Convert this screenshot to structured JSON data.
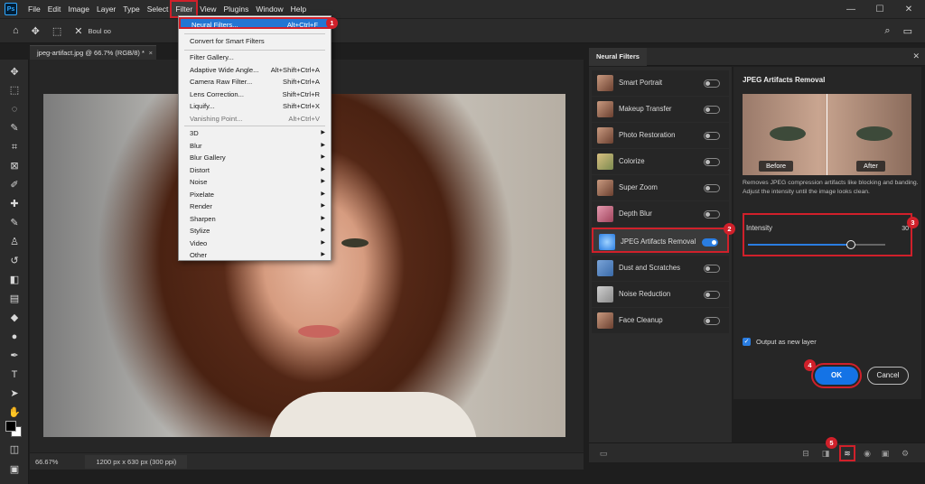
{
  "app": {
    "logo": "Ps"
  },
  "menubar": {
    "items": [
      {
        "label": "File"
      },
      {
        "label": "Edit"
      },
      {
        "label": "Image"
      },
      {
        "label": "Layer"
      },
      {
        "label": "Type"
      },
      {
        "label": "Select"
      },
      {
        "label": "Filter"
      },
      {
        "label": "View"
      },
      {
        "label": "Plugins"
      },
      {
        "label": "Window"
      },
      {
        "label": "Help"
      }
    ],
    "active": "Filter"
  },
  "options_bar": {
    "text": "Boul oo"
  },
  "document": {
    "tab_title": "jpeg-artifact.jpg @ 66.7% (RGB/8) *",
    "zoom": "66.67%",
    "info": "1200 px x 630 px (300 ppi)"
  },
  "filter_menu": {
    "neural_filters": {
      "label": "Neural Filters...",
      "shortcut": "Alt+Ctrl+F"
    },
    "convert": {
      "label": "Convert for Smart Filters"
    },
    "filter_gallery": {
      "label": "Filter Gallery..."
    },
    "adaptive_wide_angle": {
      "label": "Adaptive Wide Angle...",
      "shortcut": "Alt+Shift+Ctrl+A"
    },
    "camera_raw": {
      "label": "Camera Raw Filter...",
      "shortcut": "Shift+Ctrl+A"
    },
    "lens_correction": {
      "label": "Lens Correction...",
      "shortcut": "Shift+Ctrl+R"
    },
    "liquify": {
      "label": "Liquify...",
      "shortcut": "Shift+Ctrl+X"
    },
    "vanishing_point": {
      "label": "Vanishing Point...",
      "shortcut": "Alt+Ctrl+V"
    },
    "submenus": [
      "3D",
      "Blur",
      "Blur Gallery",
      "Distort",
      "Noise",
      "Pixelate",
      "Render",
      "Sharpen",
      "Stylize",
      "Video",
      "Other"
    ]
  },
  "neural_filters": {
    "panel_title": "Neural Filters",
    "list": [
      {
        "label": "Smart Portrait",
        "on": false
      },
      {
        "label": "Makeup Transfer",
        "on": false
      },
      {
        "label": "Photo Restoration",
        "on": false
      },
      {
        "label": "Colorize",
        "on": false
      },
      {
        "label": "Super Zoom",
        "on": false
      },
      {
        "label": "Depth Blur",
        "on": false
      },
      {
        "label": "JPEG Artifacts Removal",
        "on": true
      },
      {
        "label": "Dust and Scratches",
        "on": false
      },
      {
        "label": "Noise Reduction",
        "on": false
      },
      {
        "label": "Face Cleanup",
        "on": false
      }
    ],
    "detail": {
      "title": "JPEG Artifacts Removal",
      "before_label": "Before",
      "after_label": "After",
      "description": "Removes JPEG compression artifacts like blocking and banding. Adjust the intensity until the image looks clean.",
      "intensity_label": "Intensity",
      "intensity_value": "30",
      "intensity_fraction": 0.75,
      "output_label": "Output as new layer",
      "ok_label": "OK",
      "cancel_label": "Cancel"
    }
  },
  "badges": [
    "1",
    "2",
    "3",
    "4",
    "5"
  ],
  "colors": {
    "accent": "#1473e6",
    "highlight": "#d0202a"
  }
}
